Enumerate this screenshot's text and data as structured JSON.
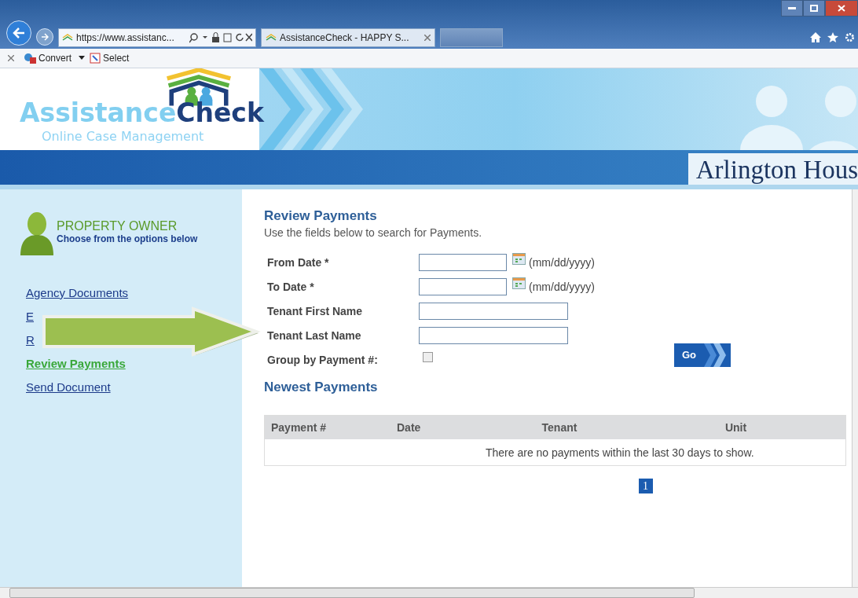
{
  "browser": {
    "address": "https://www.assistanc...",
    "tab_title": "AssistanceCheck - HAPPY S...",
    "toolbar": [
      {
        "label": "Convert",
        "kind": "menu"
      },
      {
        "label": "Select",
        "kind": "plain"
      }
    ]
  },
  "header": {
    "logo_light": "Assistance",
    "logo_dark": "Check",
    "tagline": "Online Case Management",
    "band_title": "Arlington Hous"
  },
  "sidebar": {
    "role": "PROPERTY OWNER",
    "subtitle": "Choose from the options below",
    "links": [
      {
        "label": "Agency Documents",
        "selected": false
      },
      {
        "label": "E",
        "selected": false
      },
      {
        "label": "R",
        "selected": false
      },
      {
        "label": "Review Payments",
        "selected": true
      },
      {
        "label": "Send Document",
        "selected": false
      }
    ]
  },
  "main": {
    "title": "Review Payments",
    "intro": "Use the fields below to search for Payments.",
    "fields": [
      {
        "label": "From Date *",
        "kind": "date",
        "hint": "(mm/dd/yyyy)"
      },
      {
        "label": "To Date *",
        "kind": "date",
        "hint": "(mm/dd/yyyy)"
      },
      {
        "label": "Tenant First Name",
        "kind": "text"
      },
      {
        "label": "Tenant Last Name",
        "kind": "text"
      },
      {
        "label": "Group by Payment #:",
        "kind": "checkbox",
        "checked": false
      }
    ],
    "go_button": "Go",
    "section_title": "Newest Payments",
    "table": {
      "columns": [
        "Payment #",
        "Date",
        "Tenant",
        "Unit"
      ],
      "empty_message": "There are no payments within the last 30 days to show."
    },
    "pages": [
      {
        "label": "1",
        "selected": true
      }
    ]
  }
}
